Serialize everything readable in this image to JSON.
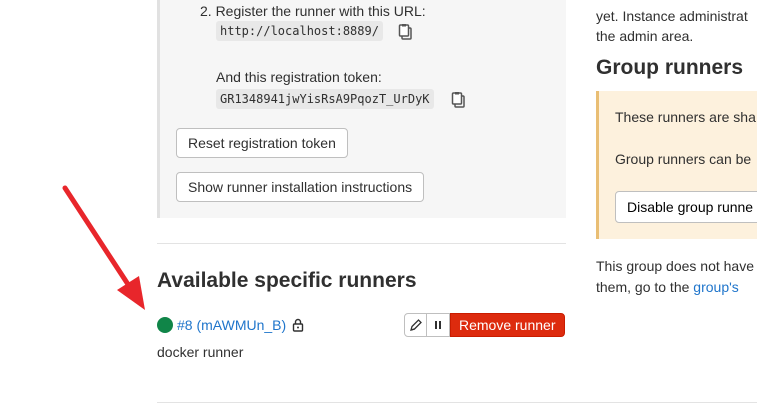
{
  "setup": {
    "step2_text": "2. Register the runner with this URL:",
    "url_value": "http://localhost:8889/",
    "token_label": "And this registration token:",
    "token_value": "GR1348941jwYisRsA9PqozT_UrDyK",
    "reset_button": "Reset registration token",
    "instructions_button": "Show runner installation instructions"
  },
  "specific_runners": {
    "title": "Available specific runners",
    "runner": {
      "id_label": "#8 (mAWMUn_B)",
      "description": "docker runner",
      "status_color": "#108548",
      "remove_label": "Remove runner"
    }
  },
  "right": {
    "line1": "yet. Instance administrat",
    "line2": "the admin area.",
    "group_title": "Group runners",
    "alert_line1": "These runners are sha",
    "alert_line2": "Group runners can be",
    "disable_button": "Disable group runne",
    "bottom_line1": "This group does not have",
    "bottom_line2_prefix": "them, go to the ",
    "bottom_link": "group's"
  },
  "colors": {
    "accent_link": "#1f75cb",
    "danger": "#dd2b0e",
    "success": "#108548",
    "annotation_arrow": "#e8262b"
  }
}
